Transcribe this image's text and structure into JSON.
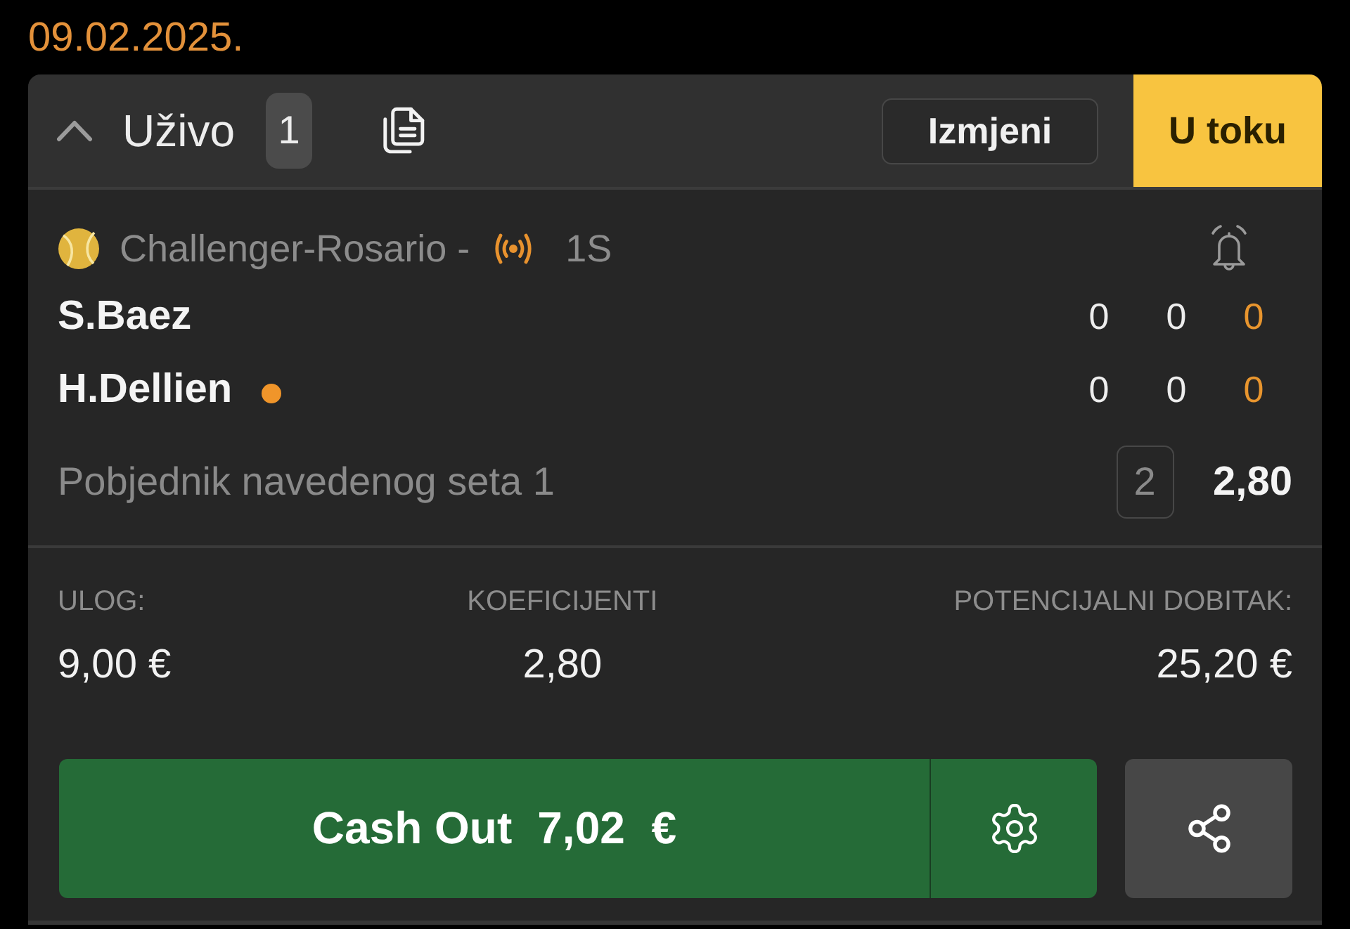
{
  "date": "09.02.2025.",
  "section": {
    "title": "Uživo",
    "expanded": true,
    "count": "1"
  },
  "filters": [
    {
      "label": "Izmjeni",
      "selected": false
    },
    {
      "label": "U toku",
      "selected": true
    }
  ],
  "event": {
    "tournament": "Challenger-Rosario -",
    "live": true,
    "period": "1S",
    "players": [
      {
        "name": "S.Baez",
        "serving": false,
        "scores": [
          {
            "value": "0",
            "current": false
          },
          {
            "value": "0",
            "current": false
          },
          {
            "value": "0",
            "current": true
          }
        ]
      },
      {
        "name": "H.Dellien",
        "serving": true,
        "scores": [
          {
            "value": "0",
            "current": false
          },
          {
            "value": "0",
            "current": false
          },
          {
            "value": "0",
            "current": true
          }
        ]
      }
    ]
  },
  "selection": {
    "market": "Pobjednik navedenog seta 1",
    "pick": "2",
    "odds": "2,80"
  },
  "summary": [
    {
      "label": "ULOG:",
      "value": "9,00 €"
    },
    {
      "label": "KOEFICIJENTI",
      "value": "2,80"
    },
    {
      "label": "POTENCIJALNI DOBITAK:",
      "value": "25,20 €"
    }
  ],
  "cash_out": {
    "label": "Cash Out",
    "amount": "7,02 €"
  }
}
